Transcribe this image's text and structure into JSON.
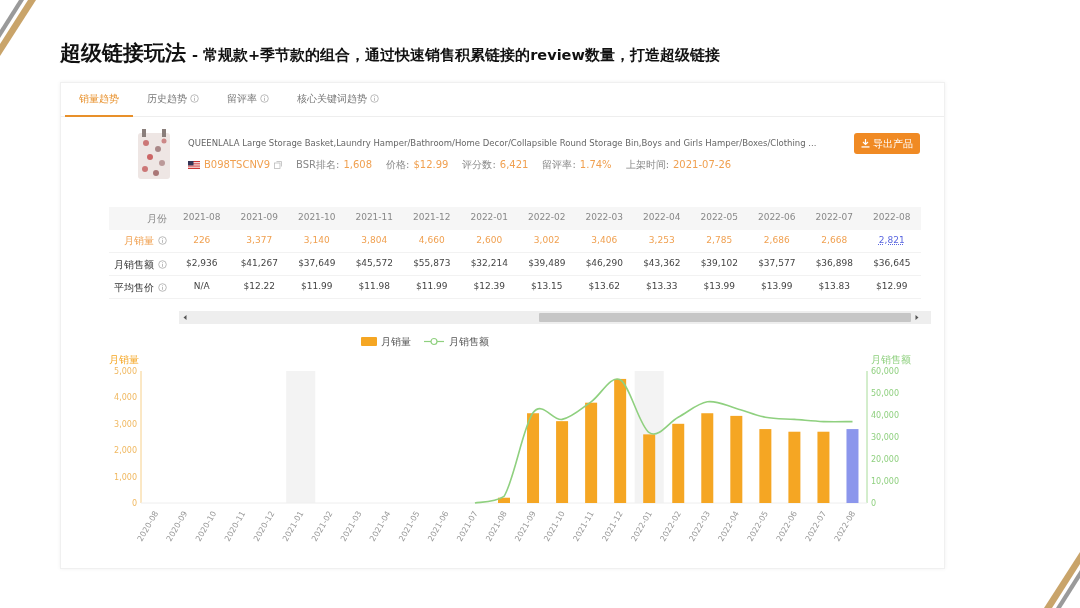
{
  "slide": {
    "title": "超级链接玩法",
    "subtitle": "- 常规款+季节款的组合，通过快速销售积累链接的review数量，打造超级链接"
  },
  "tabs": [
    {
      "label": "销量趋势",
      "selected": true,
      "info": false
    },
    {
      "label": "历史趋势",
      "selected": false,
      "info": true
    },
    {
      "label": "留评率",
      "selected": false,
      "info": true
    },
    {
      "label": "核心关键词趋势",
      "selected": false,
      "info": true
    }
  ],
  "product": {
    "title": "QUEENLALA Large Storage Basket,Laundry Hamper/Bathroom/Home Decor/Collapsible Round Storage Bin,Boys and Girls Hamper/Boxes/Clothing ...",
    "asin": "B098TSCNV9",
    "stats": [
      {
        "label": "BSR排名:",
        "value": "1,608"
      },
      {
        "label": "价格:",
        "value": "$12.99"
      },
      {
        "label": "评分数:",
        "value": "6,421"
      },
      {
        "label": "留评率:",
        "value": "1.74%"
      },
      {
        "label": "上架时间:",
        "value": "2021-07-26"
      }
    ],
    "export_button": "导出产品"
  },
  "table": {
    "header": "月份",
    "columns": [
      {
        "label": "2021-08",
        "selected": false
      },
      {
        "label": "2021-09",
        "selected": false
      },
      {
        "label": "2021-10",
        "selected": false
      },
      {
        "label": "2021-11",
        "selected": false
      },
      {
        "label": "2021-12",
        "selected": false
      },
      {
        "label": "2022-01",
        "selected": false
      },
      {
        "label": "2022-02",
        "selected": false
      },
      {
        "label": "2022-03",
        "selected": false
      },
      {
        "label": "2022-04",
        "selected": false
      },
      {
        "label": "2022-05",
        "selected": false
      },
      {
        "label": "2022-06",
        "selected": false
      },
      {
        "label": "2022-07",
        "selected": false
      },
      {
        "label": "2022-08",
        "selected": true
      }
    ],
    "rows": [
      {
        "label": "月销量",
        "kind": "sales",
        "info": true,
        "cells": [
          "226",
          "3,377",
          "3,140",
          "3,804",
          "4,660",
          "2,600",
          "3,002",
          "3,406",
          "3,253",
          "2,785",
          "2,686",
          "2,668",
          "2,821"
        ]
      },
      {
        "label": "月销售额",
        "kind": "revenue",
        "info": true,
        "cells": [
          "$2,936",
          "$41,267",
          "$37,649",
          "$45,572",
          "$55,873",
          "$32,214",
          "$39,489",
          "$46,290",
          "$43,362",
          "$39,102",
          "$37,577",
          "$36,898",
          "$36,645"
        ]
      },
      {
        "label": "平均售价",
        "kind": "price",
        "info": true,
        "cells": [
          "N/A",
          "$12.22",
          "$11.99",
          "$11.98",
          "$11.99",
          "$12.39",
          "$13.15",
          "$13.62",
          "$13.33",
          "$13.99",
          "$13.99",
          "$13.83",
          "$12.99"
        ]
      }
    ]
  },
  "chart": {
    "chart_data": {
      "type": "bar",
      "ylabel": "月销量",
      "y2label": "月销售额",
      "categories": [
        "2020-08",
        "2020-09",
        "2020-10",
        "2020-11",
        "2020-12",
        "2021-01",
        "2021-02",
        "2021-03",
        "2021-04",
        "2021-05",
        "2021-06",
        "2021-07",
        "2021-08",
        "2021-09",
        "2021-10",
        "2021-11",
        "2021-12",
        "2022-01",
        "2022-02",
        "2022-03",
        "2022-04",
        "2022-05",
        "2022-06",
        "2022-07",
        "2022-08"
      ],
      "series": [
        {
          "name": "月销量",
          "type": "bar",
          "color": "#f5a623",
          "colors": [
            null,
            null,
            null,
            null,
            null,
            null,
            null,
            null,
            null,
            null,
            null,
            null,
            "#f5a623",
            "#f5a623",
            "#f5a623",
            "#f5a623",
            "#f5a623",
            "#f5a623",
            "#f5a623",
            "#f5a623",
            "#f5a623",
            "#f5a623",
            "#f5a623",
            "#f5a623",
            "#8b96ec"
          ],
          "values": [
            null,
            null,
            null,
            null,
            null,
            null,
            null,
            null,
            null,
            null,
            null,
            null,
            200,
            3400,
            3100,
            3800,
            4700,
            2600,
            3000,
            3400,
            3300,
            2800,
            2700,
            2700,
            2800
          ]
        },
        {
          "name": "月销售额",
          "type": "line",
          "axis": "y2",
          "color": "#8fd07f",
          "values": [
            null,
            null,
            null,
            null,
            null,
            null,
            null,
            null,
            null,
            null,
            null,
            0,
            3000,
            41000,
            38000,
            46000,
            56000,
            32000,
            39000,
            46000,
            43000,
            39000,
            38000,
            37000,
            37000
          ]
        }
      ],
      "ylim": [
        0,
        5000
      ],
      "yticks": [
        {
          "value": 0,
          "label": "0"
        },
        {
          "value": 1000,
          "label": "1,000"
        },
        {
          "value": 2000,
          "label": "2,000"
        },
        {
          "value": 3000,
          "label": "3,000"
        },
        {
          "value": 4000,
          "label": "4,000"
        },
        {
          "value": 5000,
          "label": "5,000"
        }
      ],
      "y2lim": [
        0,
        60000
      ],
      "y2ticks": [
        {
          "value": 0,
          "label": "0"
        },
        {
          "value": 10000,
          "label": "10,000"
        },
        {
          "value": 20000,
          "label": "20,000"
        },
        {
          "value": 30000,
          "label": "30,000"
        },
        {
          "value": 40000,
          "label": "40,000"
        },
        {
          "value": 50000,
          "label": "50,000"
        },
        {
          "value": 60000,
          "label": "60,000"
        }
      ]
    }
  }
}
